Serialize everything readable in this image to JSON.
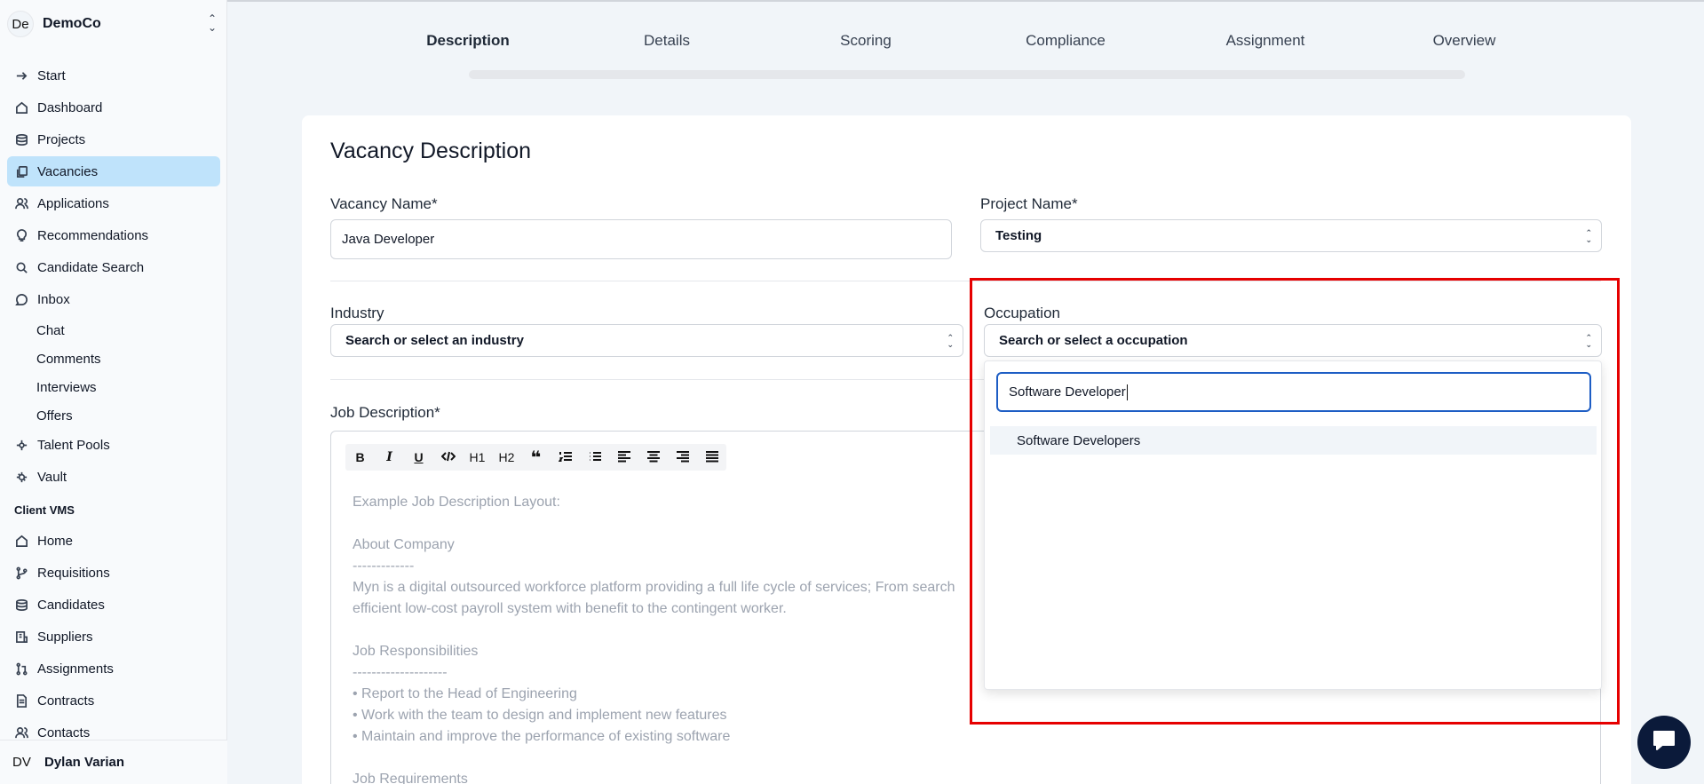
{
  "org": {
    "initials": "De",
    "name": "DemoCo"
  },
  "nav": {
    "start": "Start",
    "dashboard": "Dashboard",
    "projects": "Projects",
    "vacancies": "Vacancies",
    "applications": "Applications",
    "recommendations": "Recommendations",
    "candidate_search": "Candidate Search",
    "inbox": "Inbox",
    "chat": "Chat",
    "comments": "Comments",
    "interviews": "Interviews",
    "offers": "Offers",
    "talent_pools": "Talent Pools",
    "vault": "Vault",
    "group_client_vms": "Client VMS",
    "home": "Home",
    "requisitions": "Requisitions",
    "candidates": "Candidates",
    "suppliers": "Suppliers",
    "assignments": "Assignments",
    "contracts": "Contracts",
    "contacts": "Contacts"
  },
  "user": {
    "initials": "DV",
    "name": "Dylan Varian"
  },
  "steps": [
    "Description",
    "Details",
    "Scoring",
    "Compliance",
    "Assignment",
    "Overview"
  ],
  "form": {
    "title": "Vacancy Description",
    "vacancy_name_label": "Vacancy Name*",
    "vacancy_name_value": "Java Developer",
    "project_name_label": "Project Name*",
    "project_name_value": "Testing",
    "industry_label": "Industry",
    "industry_placeholder": "Search or select an industry",
    "occupation_label": "Occupation",
    "occupation_placeholder": "Search or select a occupation",
    "job_description_label": "Job Description*",
    "job_description_placeholder": "Example Job Description Layout:\n\nAbout Company\n-------------\nMyn is a digital outsourced workforce platform providing a full life cycle of services; From search\nefficient low-cost payroll system with benefit to the contingent worker.\n\nJob Responsibilities\n--------------------\n• Report to the Head of Engineering\n• Work with the team to design and implement new features\n• Maintain and improve the performance of existing software\n\nJob Requirements"
  },
  "toolbar": {
    "h1": "H1",
    "h2": "H2"
  },
  "occupation_dropdown": {
    "search_value": "Software Developer",
    "options": [
      "Software Developers"
    ]
  }
}
